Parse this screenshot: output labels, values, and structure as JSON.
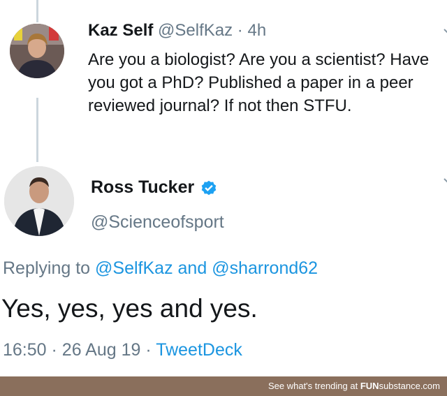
{
  "tweet1": {
    "name": "Kaz Self",
    "handle": "@SelfKaz",
    "separator": "·",
    "time": "4h",
    "text": "Are you a biologist? Are you a scientist? Have you got a PhD? Published a paper in a peer reviewed journal? If not then STFU."
  },
  "tweet2": {
    "name": "Ross Tucker",
    "handle": "@Scienceofsport",
    "replying_prefix": "Replying to",
    "reply_to_1": "@SelfKaz",
    "reply_and": "and",
    "reply_to_2": "@sharrond62",
    "text": "Yes, yes, yes and yes.",
    "time": "16:50",
    "separator": "·",
    "date": "26 Aug 19",
    "source": "TweetDeck"
  },
  "footer": {
    "text": "See what's trending at",
    "brand_a": "FUN",
    "brand_b": "substance.com"
  },
  "colors": {
    "link": "#1b95e0",
    "muted": "#657786",
    "verified": "#1da1f2",
    "footer_bg": "#8a6f5c"
  },
  "icons": [
    "verified-badge-icon",
    "caret-down-icon"
  ]
}
